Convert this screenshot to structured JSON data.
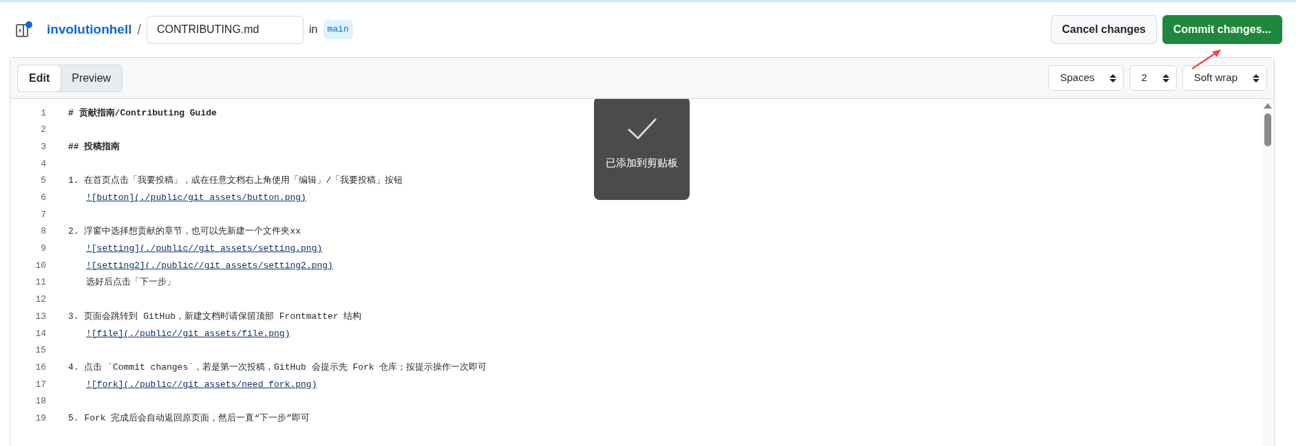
{
  "header": {
    "owner": "involutionhell",
    "separator": "/",
    "filename": "CONTRIBUTING.md",
    "in_label": "in",
    "branch": "main"
  },
  "actions": [
    {
      "label": "Cancel changes",
      "kind": "secondary"
    },
    {
      "label": "Commit changes...",
      "kind": "primary"
    }
  ],
  "editor": {
    "tabs": [
      {
        "label": "Edit",
        "selected": true
      },
      {
        "label": "Preview",
        "selected": false
      }
    ],
    "selects": [
      "Spaces",
      "2",
      "Soft wrap"
    ],
    "lines": [
      {
        "number": "1",
        "kind": "heading",
        "text": "# 贡献指南/Contributing Guide"
      },
      {
        "number": "2",
        "kind": "blank"
      },
      {
        "number": "3",
        "kind": "heading",
        "text": "## 投稿指南"
      },
      {
        "number": "4",
        "kind": "blank"
      },
      {
        "number": "5",
        "kind": "text",
        "text": "1. 在首页点击「我要投稿」，或在任意文档右上角使用「编辑」/「我要投稿」按钮"
      },
      {
        "number": "6",
        "kind": "link",
        "text": "![button](./public/git_assets/button.png)"
      },
      {
        "number": "7",
        "kind": "blank"
      },
      {
        "number": "8",
        "kind": "text",
        "text": "2. 浮窗中选择想贡献的章节，也可以先新建一个文件夹xx"
      },
      {
        "number": "9",
        "kind": "link",
        "text": "![setting](./public//git_assets/setting.png)"
      },
      {
        "number": "10",
        "kind": "link",
        "text": "![setting2](./public//git_assets/setting2.png)"
      },
      {
        "number": "11",
        "kind": "indented",
        "text": "选好后点击「下一步」"
      },
      {
        "number": "12",
        "kind": "blank"
      },
      {
        "number": "13",
        "kind": "text",
        "text": "3. 页面会跳转到 GitHub，新建文档时请保留顶部 Frontmatter 结构"
      },
      {
        "number": "14",
        "kind": "link",
        "text": "![file](./public//git_assets/file.png)"
      },
      {
        "number": "15",
        "kind": "blank"
      },
      {
        "number": "16",
        "kind": "text",
        "text": "4. 点击 `Commit changes`，若是第一次投稿，GitHub 会提示先 Fork 仓库；按提示操作一次即可"
      },
      {
        "number": "17",
        "kind": "link",
        "text": "![fork](./public//git_assets/need_fork.png)"
      },
      {
        "number": "18",
        "kind": "blank"
      },
      {
        "number": "19",
        "kind": "text",
        "text": "5. Fork 完成后会自动返回原页面，然后一直“下一步”即可"
      }
    ]
  },
  "toast": {
    "message": "已添加到剪贴板"
  }
}
